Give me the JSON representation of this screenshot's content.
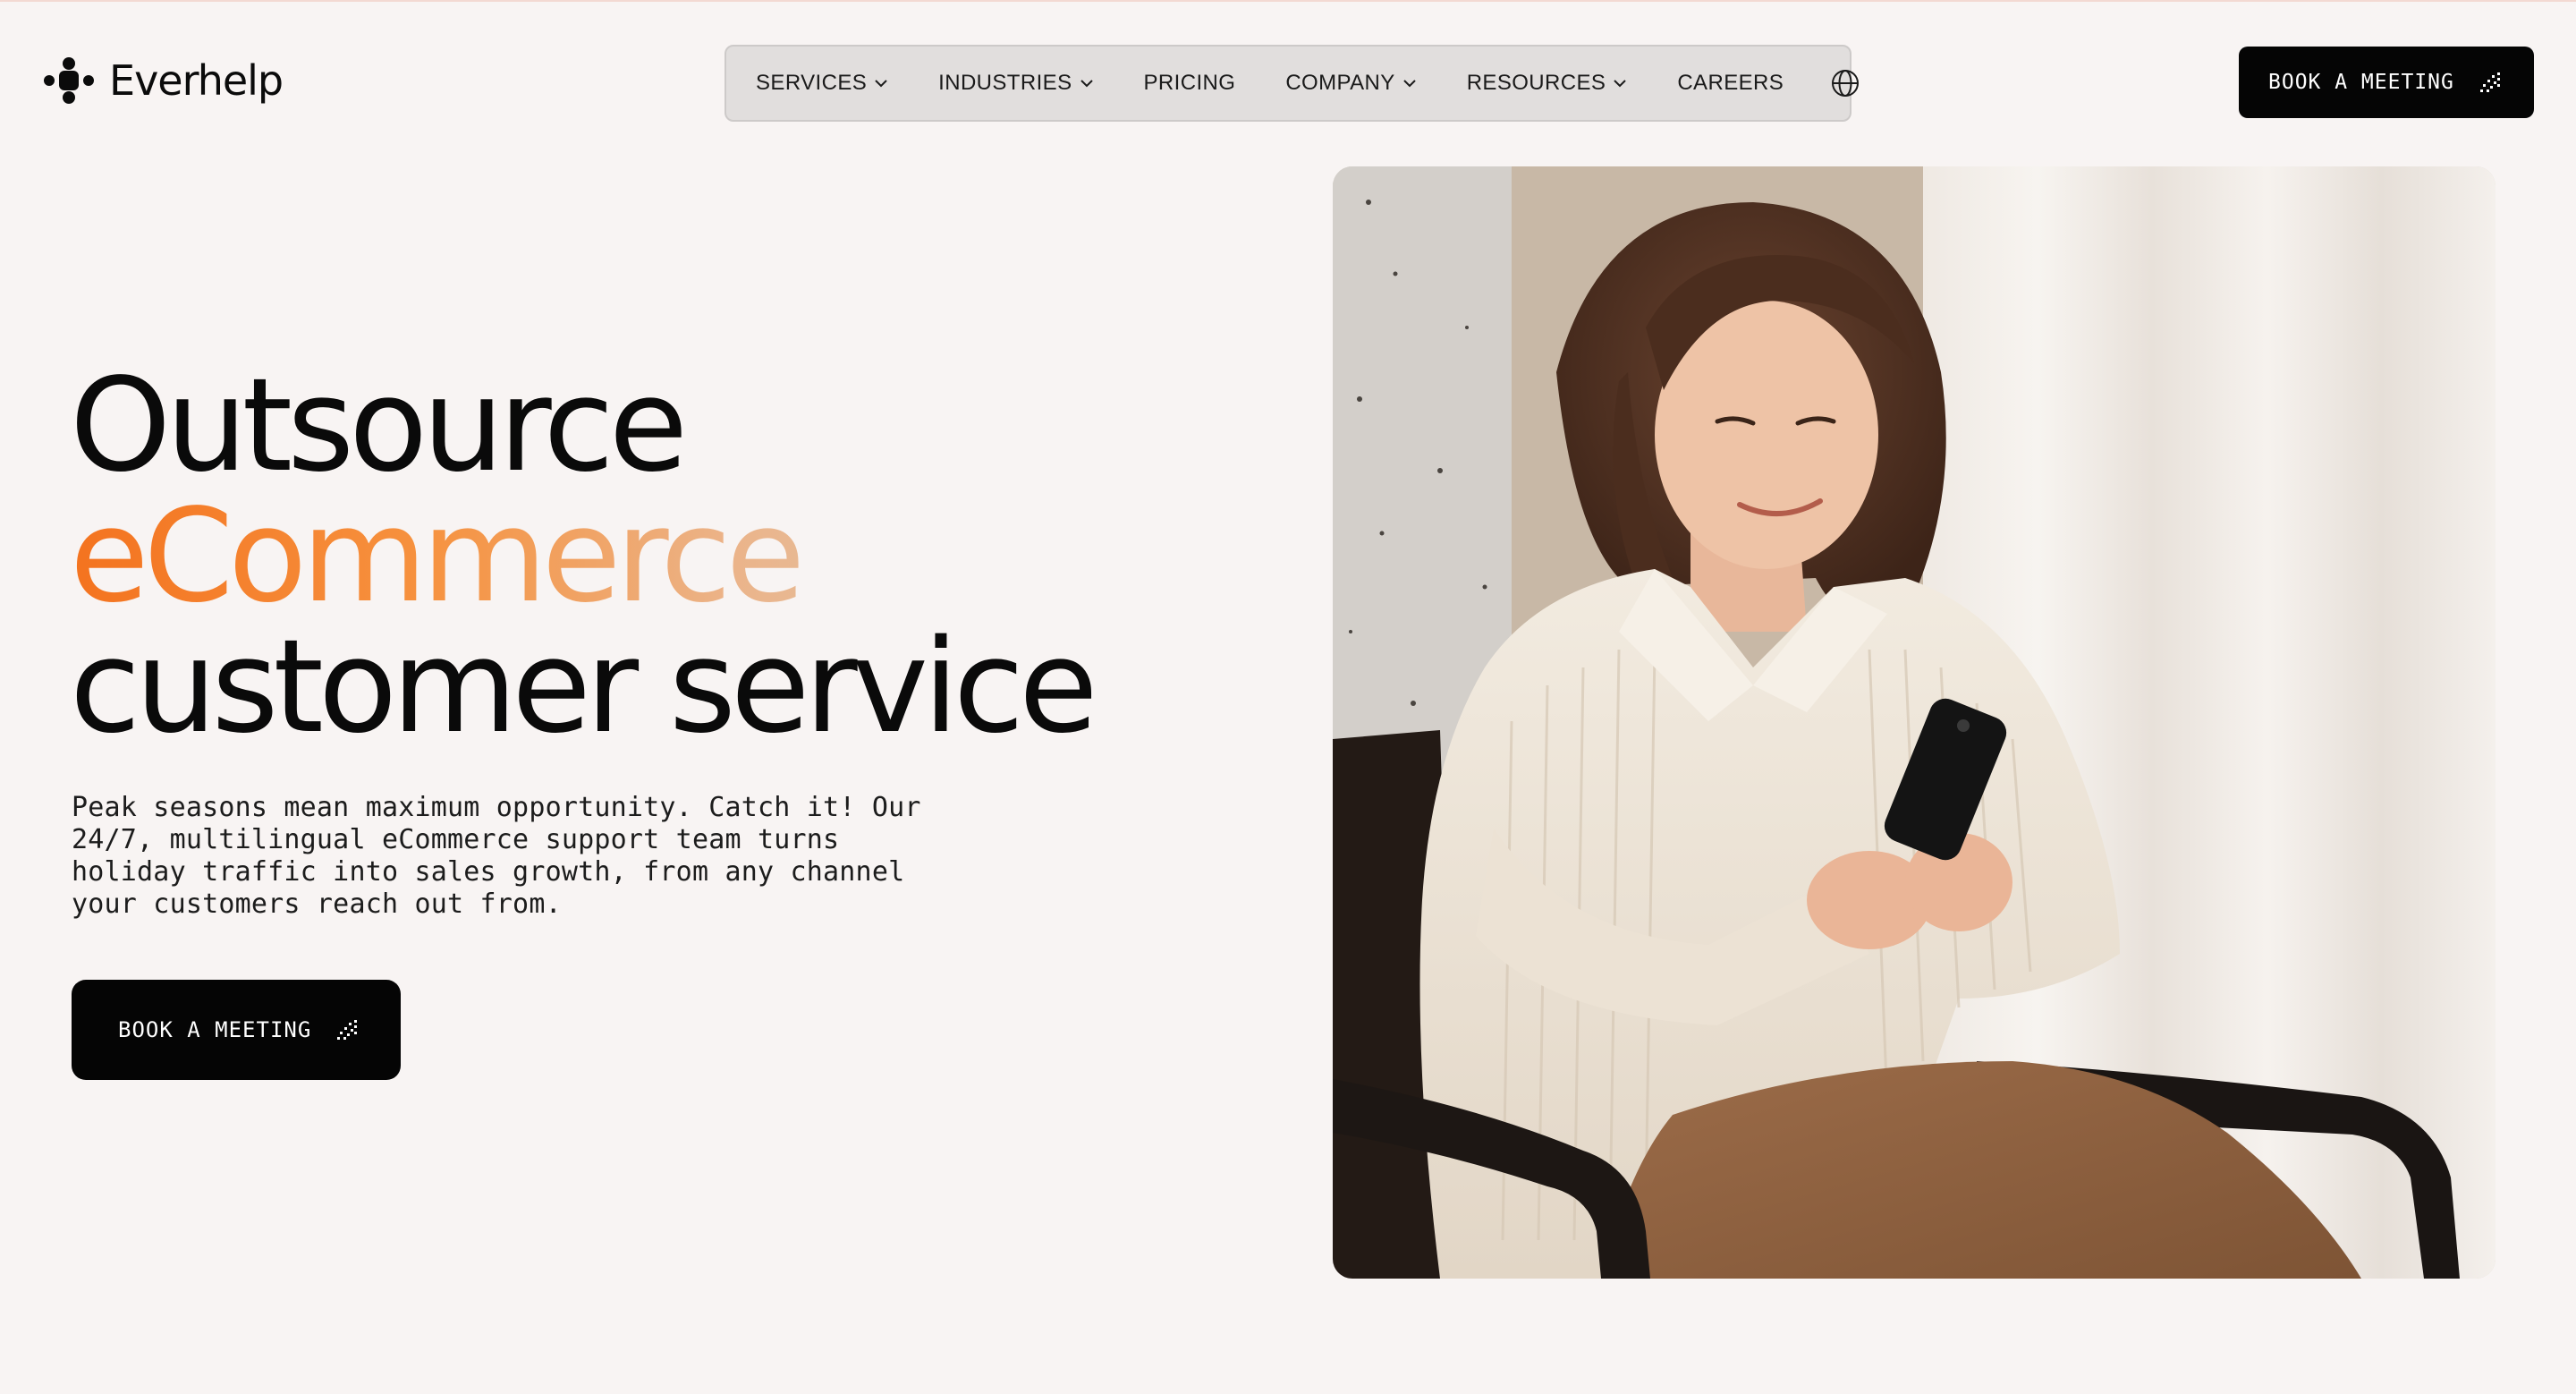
{
  "brand": {
    "name": "Everhelp"
  },
  "nav": {
    "items": [
      {
        "label": "SERVICES",
        "has_dropdown": true
      },
      {
        "label": "INDUSTRIES",
        "has_dropdown": true
      },
      {
        "label": "PRICING",
        "has_dropdown": false
      },
      {
        "label": "COMPANY",
        "has_dropdown": true
      },
      {
        "label": "RESOURCES",
        "has_dropdown": true
      },
      {
        "label": "CAREERS",
        "has_dropdown": false
      }
    ],
    "language_icon": "globe-icon"
  },
  "header": {
    "cta_label": "BOOK A MEETING",
    "cta_icon": "sparkle-icon"
  },
  "hero": {
    "headline_line1": "Outsource",
    "headline_accent": "eCommerce",
    "headline_line3": "customer service",
    "subcopy_lines": [
      "Peak seasons mean maximum opportunity. Catch it! Our",
      "24/7, multilingual eCommerce support team turns",
      "holiday traffic into sales growth, from any channel",
      "your customers reach out from."
    ],
    "cta_label": "BOOK A MEETING",
    "cta_icon": "sparkle-icon",
    "image": "woman-using-phone-photo"
  },
  "colors": {
    "background": "#f8f4f3",
    "nav_background": "#e1dedd",
    "button": "#050505",
    "accent_start": "#f4731f",
    "accent_end": "#dccab6"
  }
}
